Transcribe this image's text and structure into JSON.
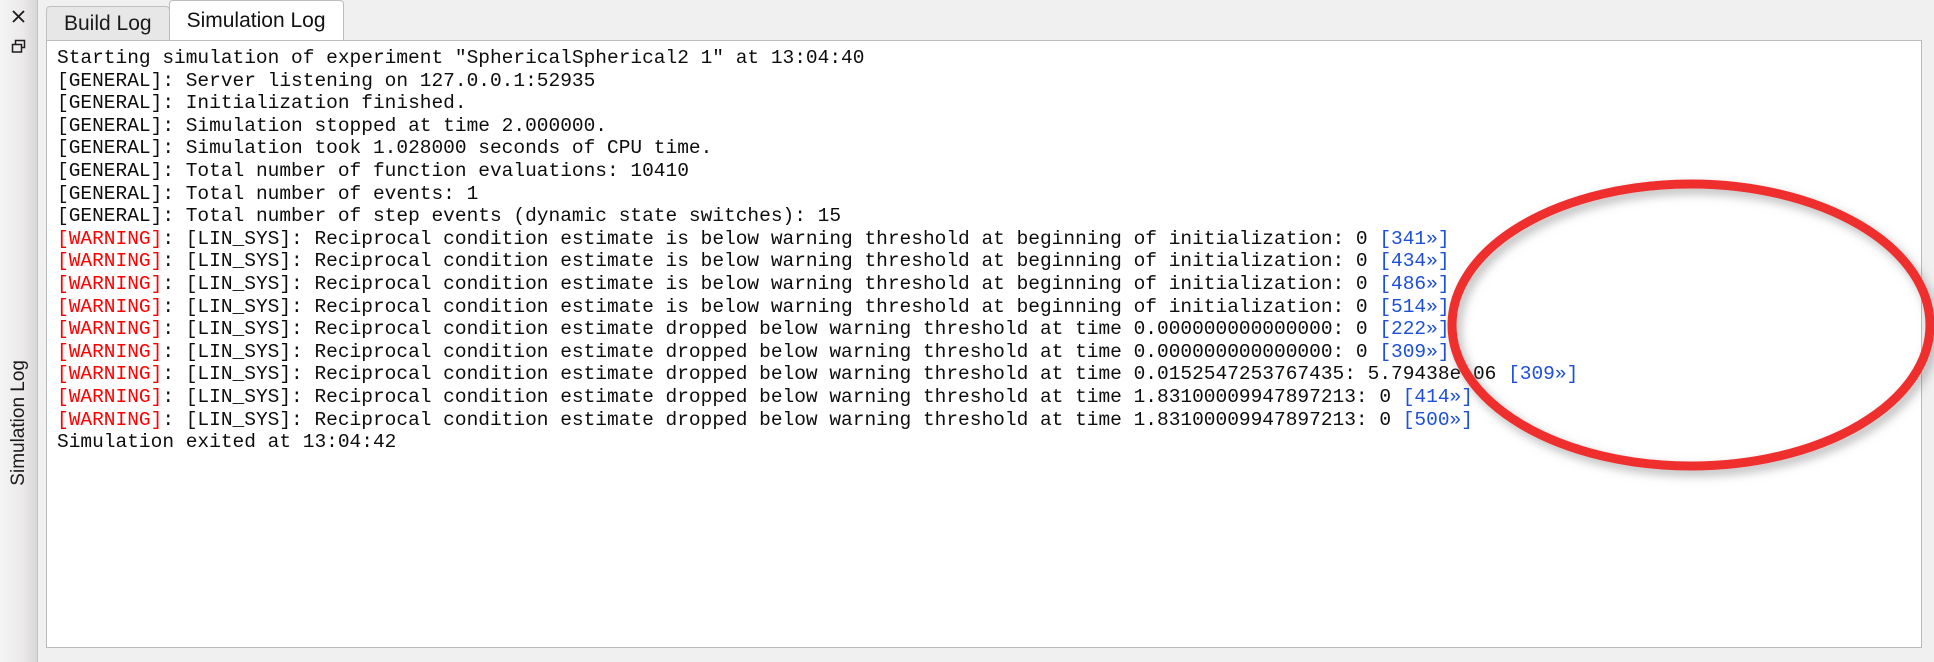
{
  "dock": {
    "close_label": "×",
    "close_icon": "close-icon",
    "restore_icon": "restore-window-icon",
    "vertical_title": "Simulation Log"
  },
  "tabs": [
    {
      "label": "Build Log",
      "active": false
    },
    {
      "label": "Simulation Log",
      "active": true
    }
  ],
  "log": {
    "lines": [
      {
        "severity": "",
        "text": "Starting simulation of experiment \"SphericalSpherical2 1\" at 13:04:40",
        "link": ""
      },
      {
        "severity": "[GENERAL]",
        "text": ": Server listening on 127.0.0.1:52935",
        "link": ""
      },
      {
        "severity": "[GENERAL]",
        "text": ": Initialization finished.",
        "link": ""
      },
      {
        "severity": "[GENERAL]",
        "text": ": Simulation stopped at time 2.000000.",
        "link": ""
      },
      {
        "severity": "[GENERAL]",
        "text": ": Simulation took 1.028000 seconds of CPU time.",
        "link": ""
      },
      {
        "severity": "[GENERAL]",
        "text": ": Total number of function evaluations: 10410",
        "link": ""
      },
      {
        "severity": "[GENERAL]",
        "text": ": Total number of events: 1",
        "link": ""
      },
      {
        "severity": "[GENERAL]",
        "text": ": Total number of step events (dynamic state switches): 15",
        "link": ""
      },
      {
        "severity": "[WARNING]",
        "text": ": [LIN_SYS]: Reciprocal condition estimate is below warning threshold at beginning of initialization: 0 ",
        "link": "[341»]"
      },
      {
        "severity": "[WARNING]",
        "text": ": [LIN_SYS]: Reciprocal condition estimate is below warning threshold at beginning of initialization: 0 ",
        "link": "[434»]"
      },
      {
        "severity": "[WARNING]",
        "text": ": [LIN_SYS]: Reciprocal condition estimate is below warning threshold at beginning of initialization: 0 ",
        "link": "[486»]"
      },
      {
        "severity": "[WARNING]",
        "text": ": [LIN_SYS]: Reciprocal condition estimate is below warning threshold at beginning of initialization: 0 ",
        "link": "[514»]"
      },
      {
        "severity": "[WARNING]",
        "text": ": [LIN_SYS]: Reciprocal condition estimate dropped below warning threshold at time 0.000000000000000: 0 ",
        "link": "[222»]"
      },
      {
        "severity": "[WARNING]",
        "text": ": [LIN_SYS]: Reciprocal condition estimate dropped below warning threshold at time 0.000000000000000: 0 ",
        "link": "[309»]"
      },
      {
        "severity": "[WARNING]",
        "text": ": [LIN_SYS]: Reciprocal condition estimate dropped below warning threshold at time 0.0152547253767435: 5.79438e-06 ",
        "link": "[309»]"
      },
      {
        "severity": "[WARNING]",
        "text": ": [LIN_SYS]: Reciprocal condition estimate dropped below warning threshold at time 1.83100009947897213: 0 ",
        "link": "[414»]"
      },
      {
        "severity": "[WARNING]",
        "text": ": [LIN_SYS]: Reciprocal condition estimate dropped below warning threshold at time 1.83100009947897213: 0 ",
        "link": "[500»]"
      },
      {
        "severity": "",
        "text": "Simulation exited at 13:04:42",
        "link": ""
      }
    ]
  },
  "annotation": {
    "shape": "ellipse",
    "color": "#ef2f2f",
    "stroke_width": 9
  },
  "colors": {
    "warning": "#fe0000",
    "link": "#1d4fd8",
    "text": "#0d0d0d",
    "annotation": "#ef2f2f",
    "tab_active_bg": "#ffffff",
    "tab_inactive_bg": "#e7e7e7"
  }
}
